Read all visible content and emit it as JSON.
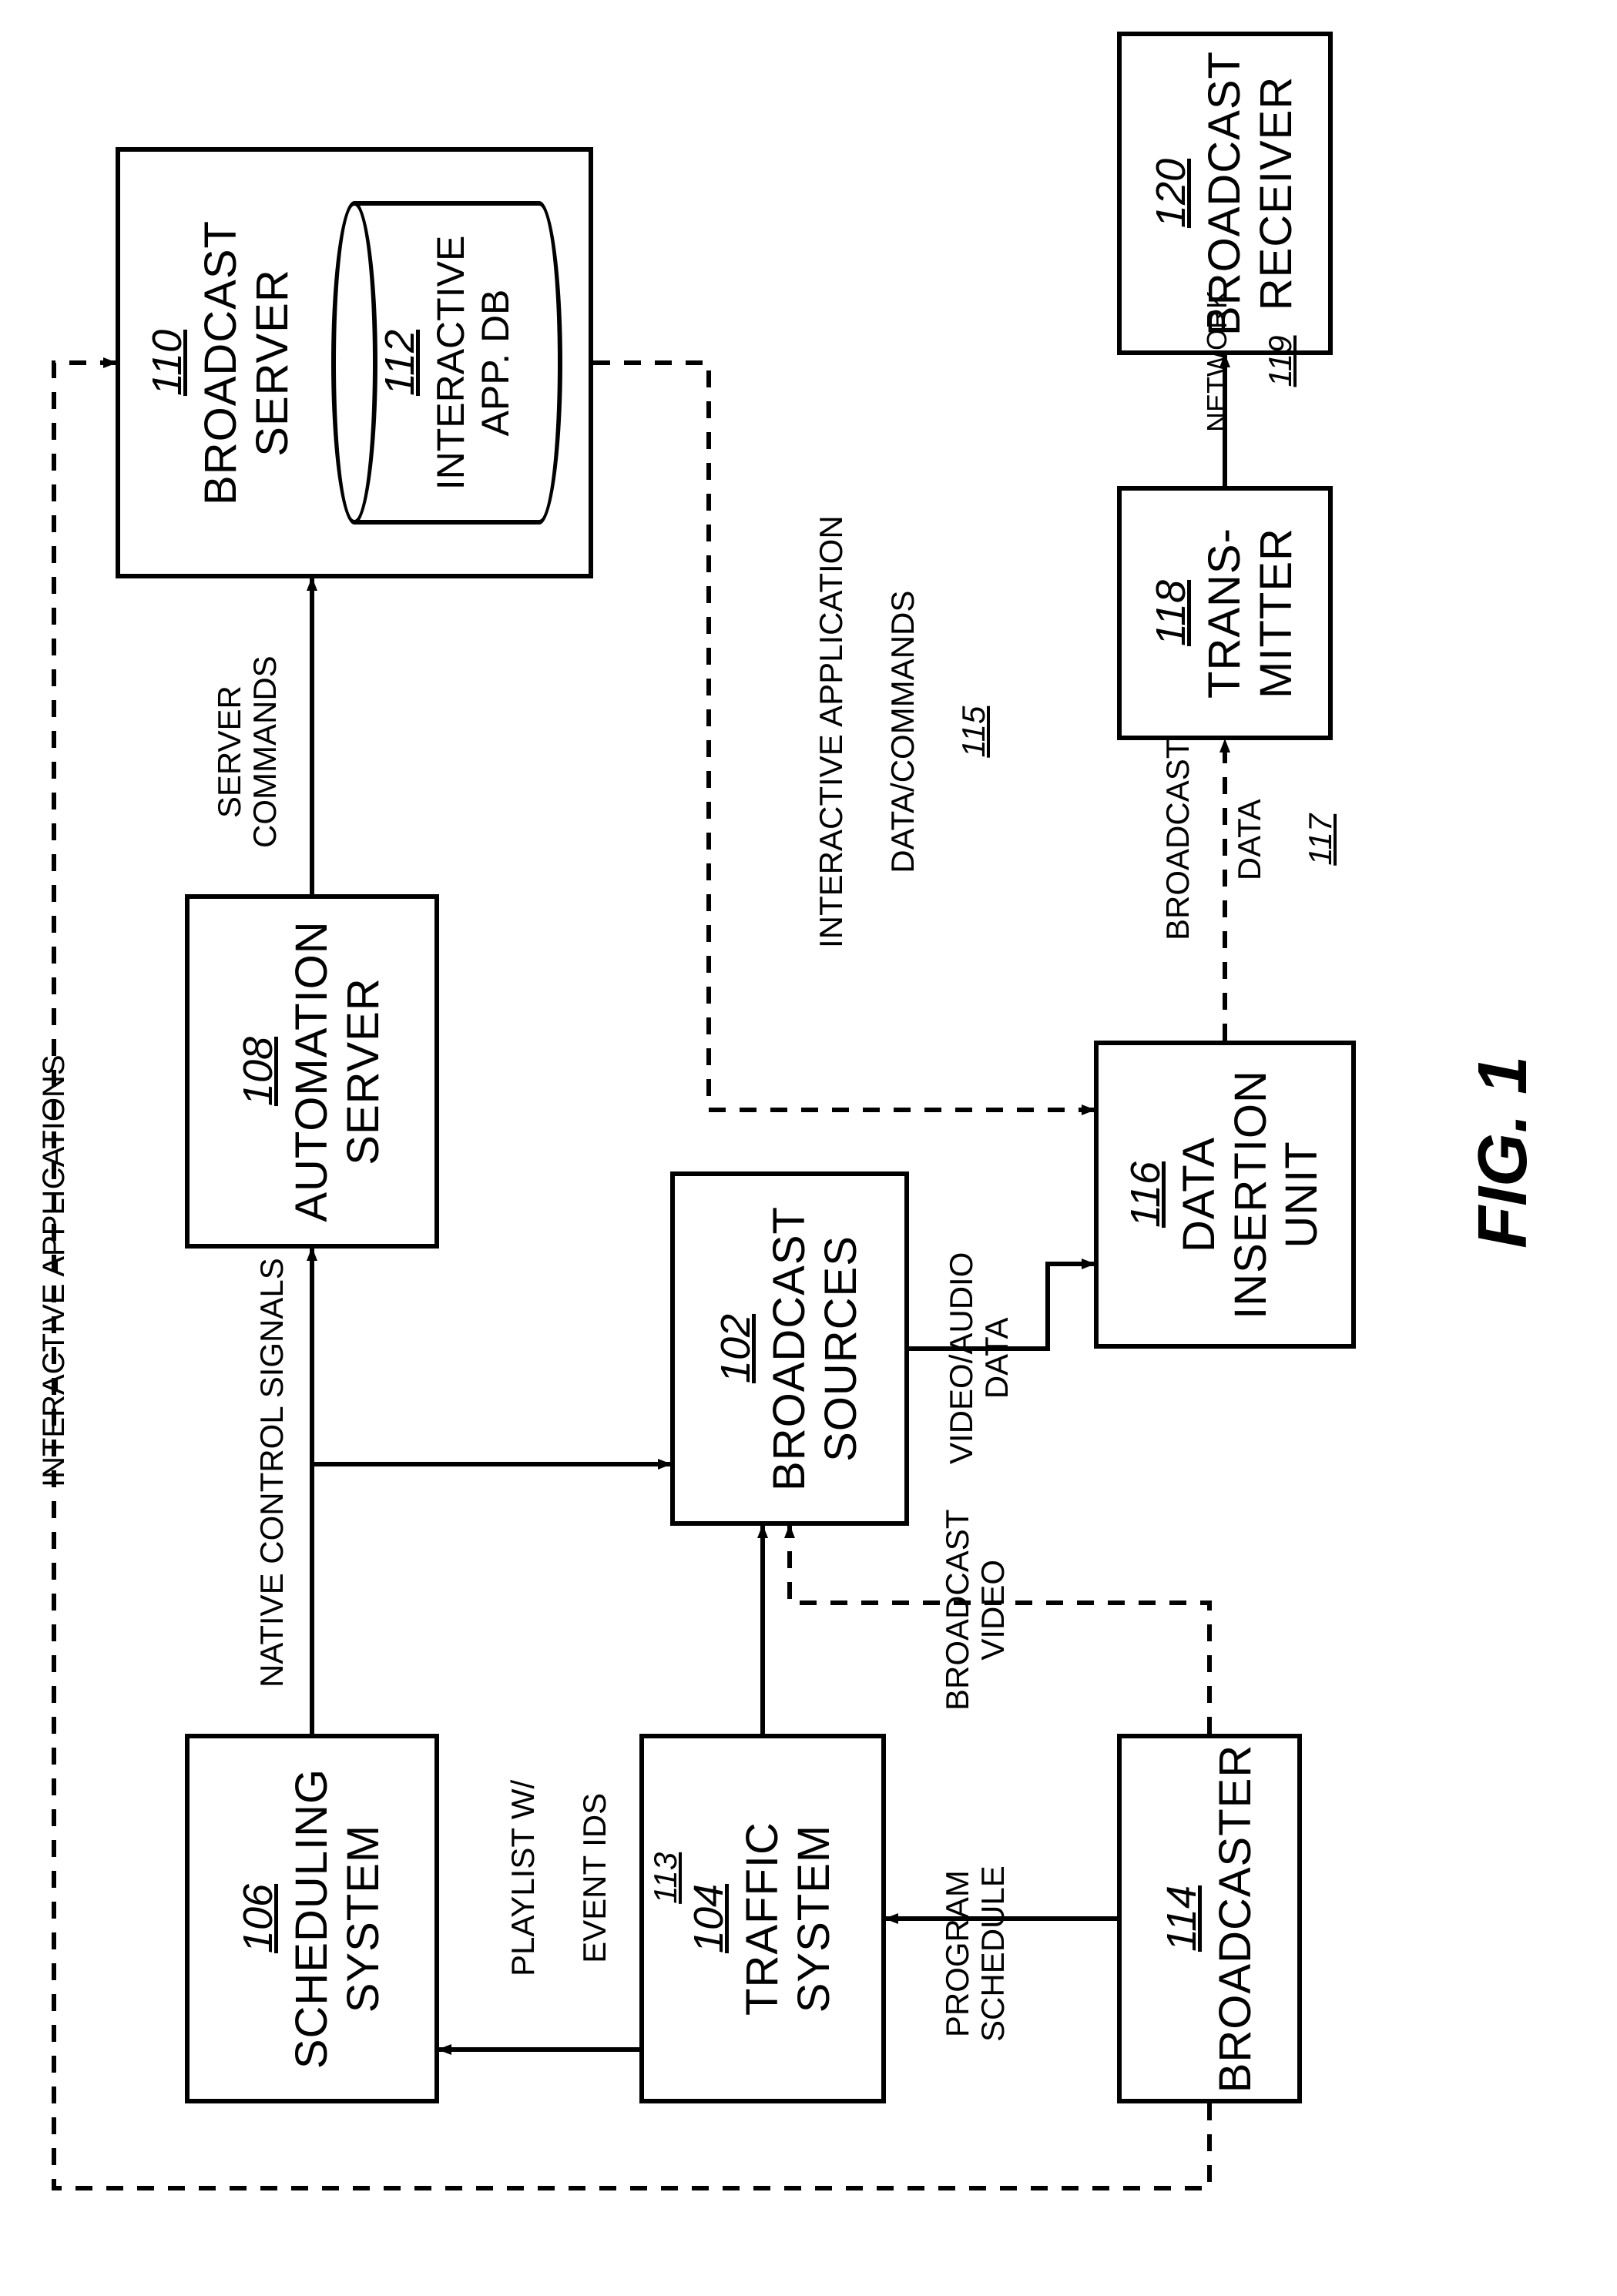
{
  "figure_caption": "FIG. 1",
  "boxes": {
    "scheduling": {
      "ref": "106",
      "line1": "SCHEDULING",
      "line2": "SYSTEM"
    },
    "traffic": {
      "ref": "104",
      "line1": "TRAFFIC",
      "line2": "SYSTEM"
    },
    "broadcaster": {
      "ref": "114",
      "line1": "BROADCASTER"
    },
    "automation": {
      "ref": "108",
      "line1": "AUTOMATION",
      "line2": "SERVER"
    },
    "bserver": {
      "ref": "110",
      "line1": "BROADCAST",
      "line2": "SERVER"
    },
    "db": {
      "ref": "112",
      "line1": "INTERACTIVE",
      "line2": "APP. DB"
    },
    "sources": {
      "ref": "102",
      "line1": "BROADCAST",
      "line2": "SOURCES"
    },
    "diu": {
      "ref": "116",
      "line1": "DATA",
      "line2": "INSERTION",
      "line3": "UNIT"
    },
    "trans": {
      "ref": "118",
      "line1": "TRANS-",
      "line2": "MITTER"
    },
    "receiver": {
      "ref": "120",
      "line1": "BROADCAST",
      "line2": "RECEIVER"
    }
  },
  "edges": {
    "interactive_apps": "INTERACTIVE APPLICATIONS",
    "native_ctrl": "NATIVE CONTROL SIGNALS",
    "server_cmds": "SERVER\nCOMMANDS",
    "playlist": {
      "line1": "PLAYLIST W/",
      "line2": "EVENT IDS",
      "ref": "113"
    },
    "program_sched": "PROGRAM\nSCHEDULE",
    "broadcast_video": "BROADCAST\nVIDEO",
    "va_data": "VIDEO/AUDIO\nDATA",
    "iad": {
      "line1": "INTERACTIVE APPLICATION",
      "line2": "DATA/COMMANDS",
      "ref": "115"
    },
    "bdata": {
      "line1": "BROADCAST",
      "line2": "DATA",
      "ref": "117"
    },
    "network": {
      "line1": "NETWORK",
      "ref": "119"
    }
  }
}
